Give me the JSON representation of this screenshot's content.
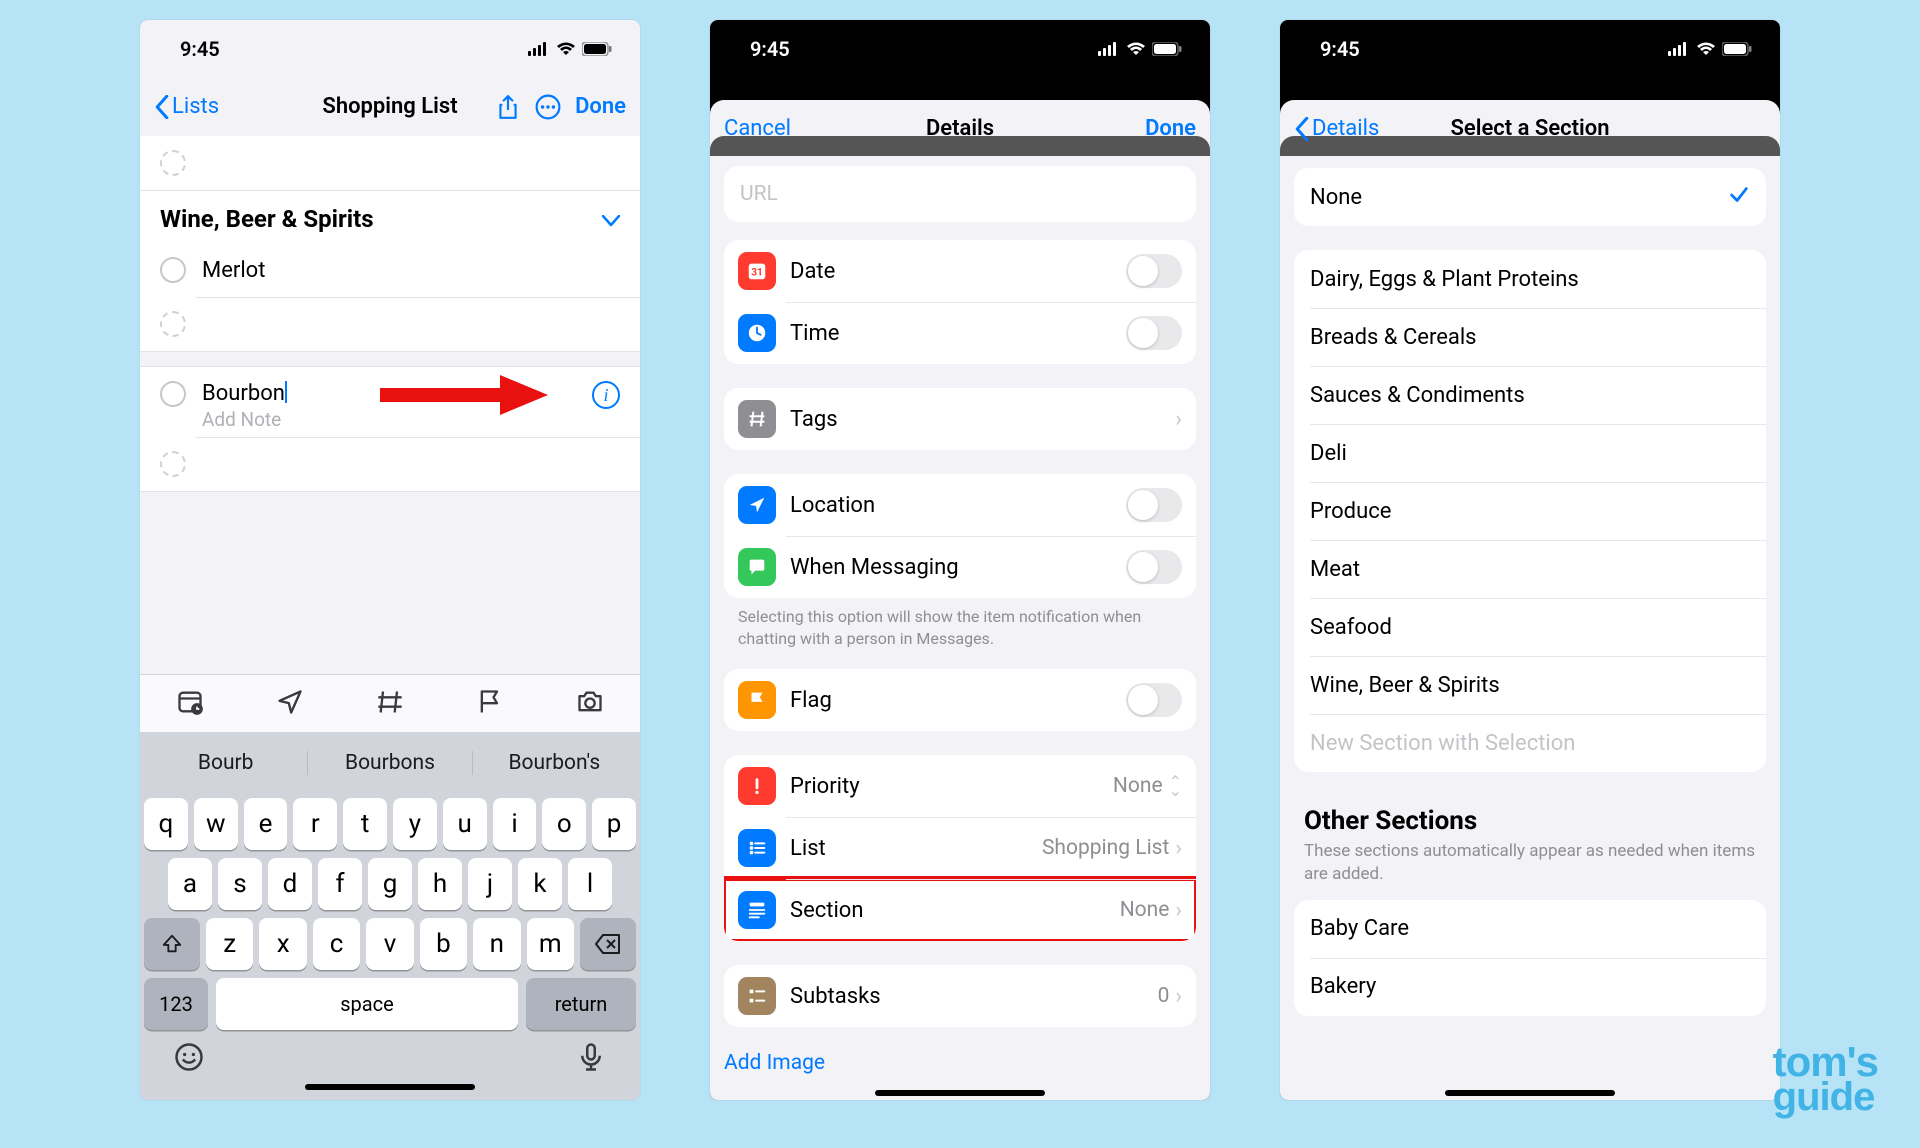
{
  "status": {
    "time": "9:45"
  },
  "watermark": {
    "line1": "tom's",
    "line2": "guide"
  },
  "phone1": {
    "back_label": "Lists",
    "title": "Shopping List",
    "done": "Done",
    "section_title": "Wine, Beer & Spirits",
    "items": {
      "merlot": "Merlot",
      "bourbon": "Bourbon"
    },
    "add_note": "Add Note",
    "keyboard": {
      "pred1": "Bourb",
      "pred2": "Bourbons",
      "pred3": "Bourbon's",
      "row1": [
        "q",
        "w",
        "e",
        "r",
        "t",
        "y",
        "u",
        "i",
        "o",
        "p"
      ],
      "row2": [
        "a",
        "s",
        "d",
        "f",
        "g",
        "h",
        "j",
        "k",
        "l"
      ],
      "row3": [
        "z",
        "x",
        "c",
        "v",
        "b",
        "n",
        "m"
      ],
      "numbers": "123",
      "space": "space",
      "return": "return"
    }
  },
  "phone2": {
    "cancel": "Cancel",
    "title": "Details",
    "done": "Done",
    "url_placeholder": "URL",
    "rows": {
      "date": "Date",
      "time": "Time",
      "tags": "Tags",
      "location": "Location",
      "messaging": "When Messaging",
      "flag": "Flag",
      "priority": "Priority",
      "list": "List",
      "section": "Section",
      "subtasks": "Subtasks",
      "add_image": "Add Image"
    },
    "values": {
      "priority": "None",
      "list": "Shopping List",
      "section": "None",
      "subtasks": "0"
    },
    "messaging_footnote": "Selecting this option will show the item notification when chatting with a person in Messages."
  },
  "phone3": {
    "back_label": "Details",
    "title": "Select a Section",
    "none": "None",
    "sections": [
      "Dairy, Eggs & Plant Proteins",
      "Breads & Cereals",
      "Sauces & Condiments",
      "Deli",
      "Produce",
      "Meat",
      "Seafood",
      "Wine, Beer & Spirits"
    ],
    "new_section": "New Section with Selection",
    "other_header": "Other Sections",
    "other_sub": "These sections automatically appear as needed when items are added.",
    "other_items": [
      "Baby Care",
      "Bakery"
    ]
  }
}
